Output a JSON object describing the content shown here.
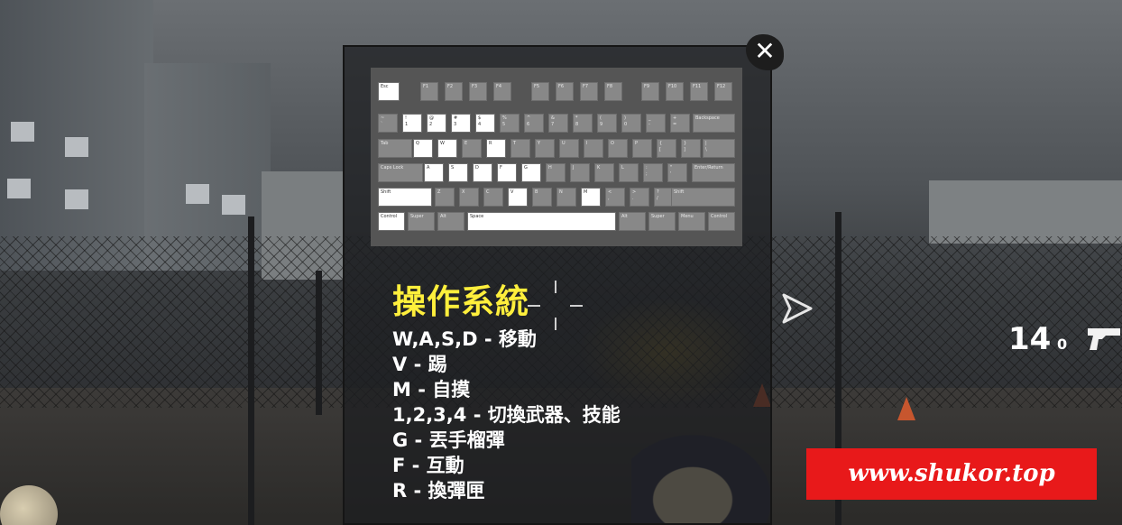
{
  "keyboard": {
    "rows": [
      [
        [
          "Esc",
          "",
          true,
          "esc"
        ],
        [
          "F1",
          "",
          false
        ],
        [
          "F2",
          "",
          false
        ],
        [
          "F3",
          "",
          false
        ],
        [
          "F4",
          "",
          false
        ],
        [
          "F5",
          "",
          false
        ],
        [
          "F6",
          "",
          false
        ],
        [
          "F7",
          "",
          false
        ],
        [
          "F8",
          "",
          false
        ],
        [
          "F9",
          "",
          false
        ],
        [
          "F10",
          "",
          false
        ],
        [
          "F11",
          "",
          false
        ],
        [
          "F12",
          "",
          false
        ]
      ],
      [
        [
          "~",
          "`",
          false
        ],
        [
          "!",
          "1",
          true
        ],
        [
          "@",
          "2",
          true
        ],
        [
          "#",
          "3",
          true
        ],
        [
          "$",
          "4",
          true
        ],
        [
          "%",
          "5",
          false
        ],
        [
          "^",
          "6",
          false
        ],
        [
          "&",
          "7",
          false
        ],
        [
          "*",
          "8",
          false
        ],
        [
          "(",
          "9",
          false
        ],
        [
          ")",
          "0",
          false
        ],
        [
          "_",
          "-",
          false
        ],
        [
          "+",
          "=",
          false
        ],
        [
          "Backspace",
          "",
          false
        ]
      ],
      [
        [
          "Tab",
          "",
          false
        ],
        [
          "Q",
          "",
          true
        ],
        [
          "W",
          "",
          true
        ],
        [
          "E",
          "",
          false
        ],
        [
          "R",
          "",
          true
        ],
        [
          "T",
          "",
          false
        ],
        [
          "Y",
          "",
          false
        ],
        [
          "U",
          "",
          false
        ],
        [
          "I",
          "",
          false
        ],
        [
          "O",
          "",
          false
        ],
        [
          "P",
          "",
          false
        ],
        [
          "{",
          "[",
          false
        ],
        [
          "}",
          "]",
          false
        ],
        [
          "|",
          "\\",
          false
        ]
      ],
      [
        [
          "Caps Lock",
          "",
          false
        ],
        [
          "A",
          "",
          true
        ],
        [
          "S",
          "",
          true
        ],
        [
          "D",
          "",
          true
        ],
        [
          "F",
          "",
          true
        ],
        [
          "G",
          "",
          true
        ],
        [
          "H",
          "",
          false
        ],
        [
          "J",
          "",
          false
        ],
        [
          "K",
          "",
          false
        ],
        [
          "L",
          "",
          false
        ],
        [
          ":",
          ";",
          false
        ],
        [
          "\"",
          "'",
          false
        ],
        [
          "Enter/Return",
          "",
          false
        ]
      ],
      [
        [
          "Shift",
          "",
          true
        ],
        [
          "Z",
          "",
          false
        ],
        [
          "X",
          "",
          false
        ],
        [
          "C",
          "",
          false
        ],
        [
          "V",
          "",
          true
        ],
        [
          "B",
          "",
          false
        ],
        [
          "N",
          "",
          false
        ],
        [
          "M",
          "",
          true
        ],
        [
          "<",
          ",",
          false
        ],
        [
          ">",
          ".",
          false
        ],
        [
          "?",
          "/",
          false
        ],
        [
          "Shift",
          "",
          false
        ]
      ],
      [
        [
          "Control",
          "",
          true
        ],
        [
          "Super",
          "",
          false
        ],
        [
          "Alt",
          "",
          false
        ],
        [
          "Space",
          "",
          true
        ],
        [
          "Alt",
          "",
          false
        ],
        [
          "Super",
          "",
          false
        ],
        [
          "Menu",
          "",
          false
        ],
        [
          "Control",
          "",
          false
        ]
      ]
    ]
  },
  "title": "操作系統",
  "controls": [
    "W,A,S,D - 移動",
    "V - 踢",
    "M - 自摸",
    "1,2,3,4 - 切換武器、技能",
    "G - 丟手榴彈",
    "F - 互動",
    "R - 換彈匣"
  ],
  "hud": {
    "ammo": "14",
    "reserve": "0"
  },
  "watermark": "www.shukor.top",
  "icons": {
    "close": "close-icon",
    "play": "play-arrow-icon",
    "gun": "pistol-icon"
  },
  "colors": {
    "title": "#ffef3c",
    "highlight_key": "#ffffff",
    "key": "#888888",
    "watermark_bg": "#e8191a"
  }
}
